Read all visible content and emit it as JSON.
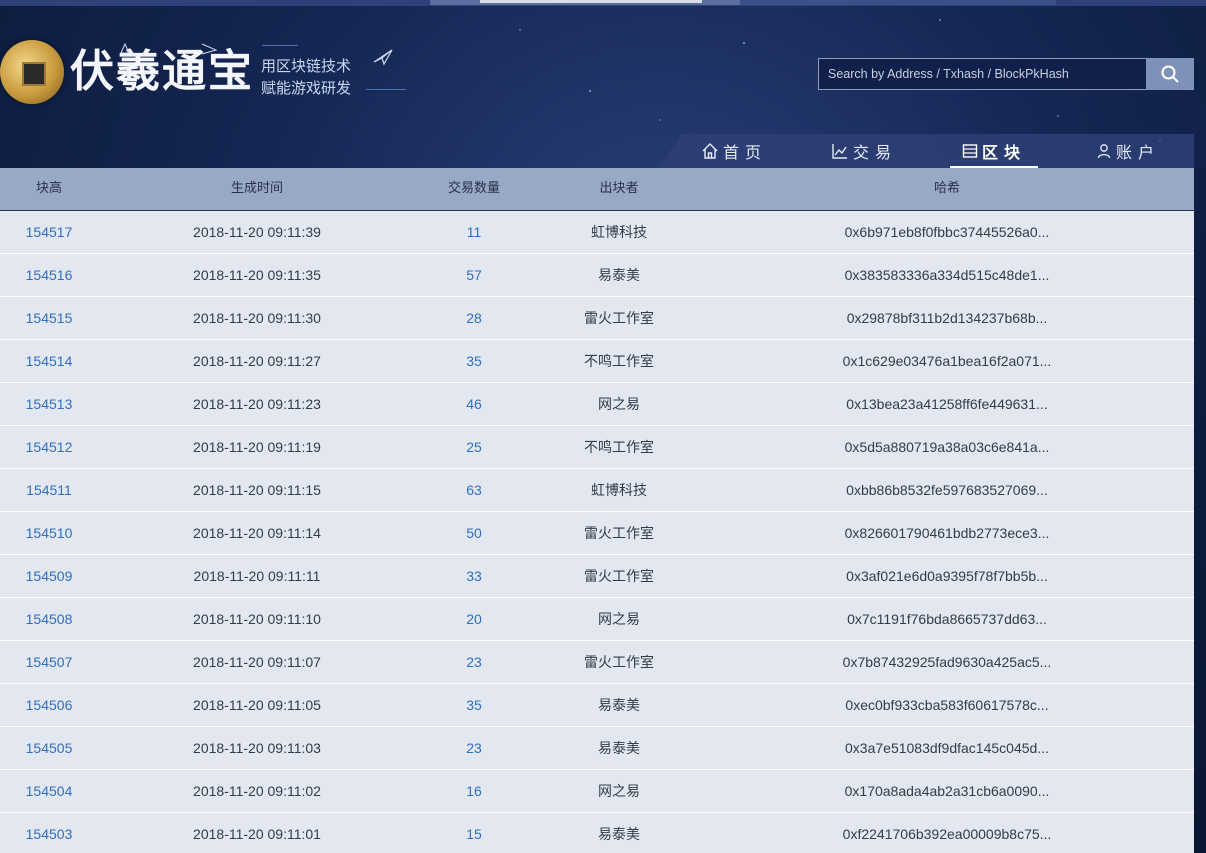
{
  "header": {
    "title": "伏羲通宝",
    "slogan_line1": "用区块链技术",
    "slogan_line2": "赋能游戏研发"
  },
  "search": {
    "placeholder": "Search by Address / Txhash / BlockPkHash",
    "button_icon": "search-icon"
  },
  "nav": {
    "items": [
      {
        "label": "首页",
        "icon": "home-icon",
        "active": false
      },
      {
        "label": "交易",
        "icon": "chart-line-icon",
        "active": false
      },
      {
        "label": "区块",
        "icon": "list-icon",
        "active": true
      },
      {
        "label": "账户",
        "icon": "user-icon",
        "active": false
      }
    ]
  },
  "table": {
    "columns": [
      "块高",
      "生成时间",
      "交易数量",
      "出块者",
      "哈希"
    ],
    "rows": [
      {
        "height": "154517",
        "time": "2018-11-20 09:11:39",
        "tx": "11",
        "miner": "虹博科技",
        "hash": "0x6b971eb8f0fbbc37445526a0..."
      },
      {
        "height": "154516",
        "time": "2018-11-20 09:11:35",
        "tx": "57",
        "miner": "易泰美",
        "hash": "0x383583336a334d515c48de1..."
      },
      {
        "height": "154515",
        "time": "2018-11-20 09:11:30",
        "tx": "28",
        "miner": "雷火工作室",
        "hash": "0x29878bf311b2d134237b68b..."
      },
      {
        "height": "154514",
        "time": "2018-11-20 09:11:27",
        "tx": "35",
        "miner": "不鸣工作室",
        "hash": "0x1c629e03476a1bea16f2a071..."
      },
      {
        "height": "154513",
        "time": "2018-11-20 09:11:23",
        "tx": "46",
        "miner": "网之易",
        "hash": "0x13bea23a41258ff6fe449631..."
      },
      {
        "height": "154512",
        "time": "2018-11-20 09:11:19",
        "tx": "25",
        "miner": "不鸣工作室",
        "hash": "0x5d5a880719a38a03c6e841a..."
      },
      {
        "height": "154511",
        "time": "2018-11-20 09:11:15",
        "tx": "63",
        "miner": "虹博科技",
        "hash": "0xbb86b8532fe597683527069..."
      },
      {
        "height": "154510",
        "time": "2018-11-20 09:11:14",
        "tx": "50",
        "miner": "雷火工作室",
        "hash": "0x826601790461bdb2773ece3..."
      },
      {
        "height": "154509",
        "time": "2018-11-20 09:11:11",
        "tx": "33",
        "miner": "雷火工作室",
        "hash": "0x3af021e6d0a9395f78f7bb5b..."
      },
      {
        "height": "154508",
        "time": "2018-11-20 09:11:10",
        "tx": "20",
        "miner": "网之易",
        "hash": "0x7c1191f76bda8665737dd63..."
      },
      {
        "height": "154507",
        "time": "2018-11-20 09:11:07",
        "tx": "23",
        "miner": "雷火工作室",
        "hash": "0x7b87432925fad9630a425ac5..."
      },
      {
        "height": "154506",
        "time": "2018-11-20 09:11:05",
        "tx": "35",
        "miner": "易泰美",
        "hash": "0xec0bf933cba583f60617578c..."
      },
      {
        "height": "154505",
        "time": "2018-11-20 09:11:03",
        "tx": "23",
        "miner": "易泰美",
        "hash": "0x3a7e51083df9dfac145c045d..."
      },
      {
        "height": "154504",
        "time": "2018-11-20 09:11:02",
        "tx": "16",
        "miner": "网之易",
        "hash": "0x170a8ada4ab2a31cb6a0090..."
      },
      {
        "height": "154503",
        "time": "2018-11-20 09:11:01",
        "tx": "15",
        "miner": "易泰美",
        "hash": "0xf2241706b392ea00009b8c75..."
      }
    ]
  }
}
